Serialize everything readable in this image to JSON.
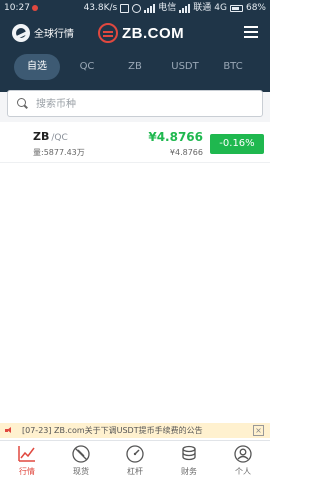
{
  "status_bar": {
    "time": "10:27",
    "speed": "43.8K/s",
    "carrier_1": "电信",
    "carrier_2": "联通",
    "network": "4G",
    "battery": "68%"
  },
  "header": {
    "global_label": "全球行情",
    "logo_text": "ZB.COM"
  },
  "tabs": [
    {
      "label": "自选",
      "active": true
    },
    {
      "label": "QC",
      "active": false
    },
    {
      "label": "ZB",
      "active": false
    },
    {
      "label": "USDT",
      "active": false
    },
    {
      "label": "BTC",
      "active": false
    }
  ],
  "search": {
    "placeholder": "搜索币种"
  },
  "market_rows": [
    {
      "base": "ZB",
      "quote": "/QC",
      "volume": "量:5877.43万",
      "price": "¥4.8766",
      "sub_price": "¥4.8766",
      "change": "-0.16%"
    }
  ],
  "announcement": {
    "text": "[07-23] ZB.com关于下调USDT提币手续费的公告"
  },
  "bottom_nav": [
    {
      "label": "行情",
      "icon": "chart-line-icon",
      "active": true
    },
    {
      "label": "现货",
      "icon": "spot-icon",
      "active": false
    },
    {
      "label": "杠杆",
      "icon": "gauge-icon",
      "active": false
    },
    {
      "label": "财务",
      "icon": "coins-icon",
      "active": false
    },
    {
      "label": "个人",
      "icon": "user-icon",
      "active": false
    }
  ],
  "colors": {
    "header_bg": "#1f3548",
    "accent_red": "#e0483f",
    "up_green": "#1fb84f",
    "notice_bg": "#fff1cf"
  }
}
